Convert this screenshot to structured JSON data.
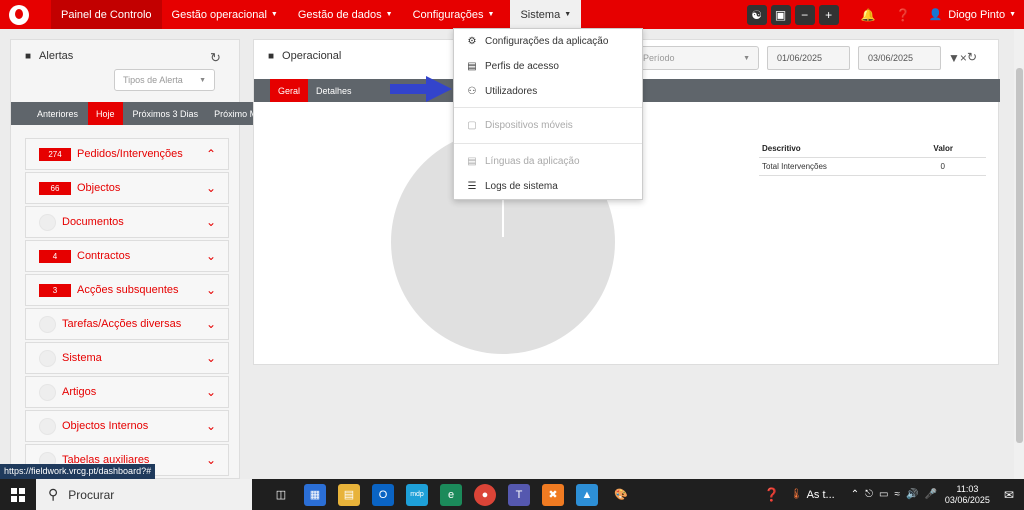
{
  "navbar": {
    "items": [
      {
        "label": "Painel de Controlo",
        "caret": false
      },
      {
        "label": "Gestão operacional",
        "caret": true
      },
      {
        "label": "Gestão de dados",
        "caret": true
      },
      {
        "label": "Configurações",
        "caret": true
      },
      {
        "label": "Sistema",
        "caret": true
      }
    ],
    "user": "Diogo Pinto"
  },
  "alerts": {
    "title": "Alertas",
    "select_placeholder": "Tipos de Alerta",
    "tabs": [
      "Anteriores",
      "Hoje",
      "Próximos 3 Dias",
      "Próximo Mês"
    ],
    "items": [
      {
        "label": "Pedidos/Intervenções",
        "badge": "274",
        "open": true
      },
      {
        "label": "Objectos",
        "badge": "66"
      },
      {
        "label": "Documentos",
        "badge": ""
      },
      {
        "label": "Contractos",
        "badge": "4"
      },
      {
        "label": "Acções subsquentes",
        "badge": "3"
      },
      {
        "label": "Tarefas/Acções diversas",
        "badge": ""
      },
      {
        "label": "Sistema",
        "badge": ""
      },
      {
        "label": "Artigos",
        "badge": ""
      },
      {
        "label": "Objectos Internos",
        "badge": ""
      },
      {
        "label": "Tabelas auxiliares",
        "badge": ""
      }
    ]
  },
  "operacional": {
    "title": "Operacional",
    "tabs": [
      "Geral",
      "Detalhes"
    ],
    "period_placeholder": "Período",
    "date_from": "01/06/2025",
    "date_to": "03/06/2025",
    "table": {
      "headers": [
        "Descritivo",
        "Valor"
      ],
      "rows": [
        [
          "Total Intervenções",
          "0"
        ]
      ]
    }
  },
  "sistema_menu": {
    "items": [
      {
        "label": "Configurações da aplicação",
        "icon": "gears-icon",
        "disabled": false
      },
      {
        "label": "Perfis de acesso",
        "icon": "profile-icon",
        "disabled": false
      },
      {
        "label": "Utilizadores",
        "icon": "users-gear-icon",
        "disabled": false
      },
      {
        "label": "Dispositivos móveis",
        "icon": "tablet-icon",
        "disabled": true
      },
      {
        "label": "Línguas da aplicação",
        "icon": "language-icon",
        "disabled": true
      },
      {
        "label": "Logs de sistema",
        "icon": "layers-icon",
        "disabled": false
      }
    ]
  },
  "status_url": "https://fieldwork.vrcg.pt/dashboard?#",
  "taskbar": {
    "search": "Procurar",
    "weather": "As t...",
    "time": "11:03",
    "date": "03/06/2025"
  },
  "colors": {
    "brand": "#e60000",
    "tabbar": "#5f656b",
    "arrow": "#3344cc"
  }
}
